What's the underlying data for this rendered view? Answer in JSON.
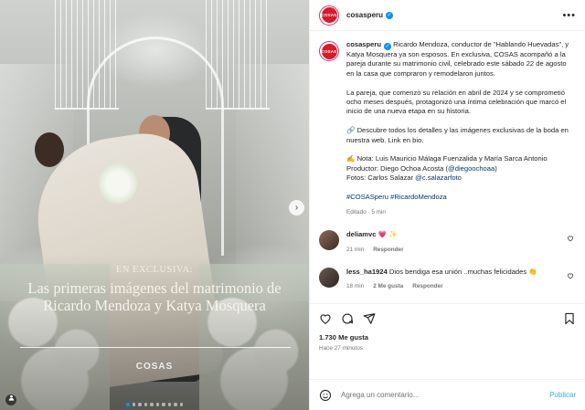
{
  "photo": {
    "kicker": "EN EXCLUSIVA:",
    "title": "Las primeras imágenes del matrimonio de Ricardo Mendoza y Katya Mosquera",
    "logo": "COSAS",
    "carousel_total": 10,
    "carousel_active": 1
  },
  "header": {
    "avatar_text": "COSAS",
    "username": "cosasperu",
    "more": "•••"
  },
  "caption": {
    "username": "cosasperu",
    "p1": " Ricardo Mendoza, conductor de \"Hablando Huevadas\", y Katya Mosquera ya son esposos. En exclusiva, COSAS acompañó a la pareja durante su matrimonio civil, celebrado este sábado 22 de agosto en la casa que compraron y remodelaron juntos.",
    "p2": "La pareja, que comenzó su relación en abril de 2024 y se comprometió ocho meses después, protagonizó una íntima celebración que marcó el inicio de una nueva etapa en su historia.",
    "p3": "🔗 Descubre todos los detalles y las imágenes exclusivas de la boda en nuestra web. Link en bio.",
    "p4_line1": "✍️ Nota: Luis Mauricio Málaga Fuenzalida y María Sarca Antonio",
    "p4_line2_prefix": "Productor: Diego Ochoa Acosta (",
    "p4_line2_link": "@diegoochoaa",
    "p4_line2_suffix": ")",
    "p4_line3_prefix": "Fotos: Carlos Salazar ",
    "p4_line3_link": "@c.salazarfoto",
    "hashtags": "#COSASperu #RicardoMendoza",
    "meta": "Editado · 5 min"
  },
  "comments": [
    {
      "username": "deliamvc",
      "text": " 💗 ✨",
      "time": "21 min",
      "reply": "Responder"
    },
    {
      "username": "less_ha1924",
      "text": " Dios bendiga esa unión ..muchas felicidades 👏",
      "time": "18 min",
      "likes": "2 Me gusta",
      "reply": "Responder"
    }
  ],
  "actions": {
    "likes": "1.730 Me gusta",
    "time": "Hace 27 minutos"
  },
  "add_comment": {
    "placeholder": "Agrega un comentario...",
    "publish": "Publicar"
  },
  "icons": [
    "heart-icon",
    "comment-icon",
    "share-icon",
    "bookmark-icon",
    "emoji-icon",
    "verified-icon",
    "more-icon",
    "next-icon",
    "tag-user-icon"
  ]
}
